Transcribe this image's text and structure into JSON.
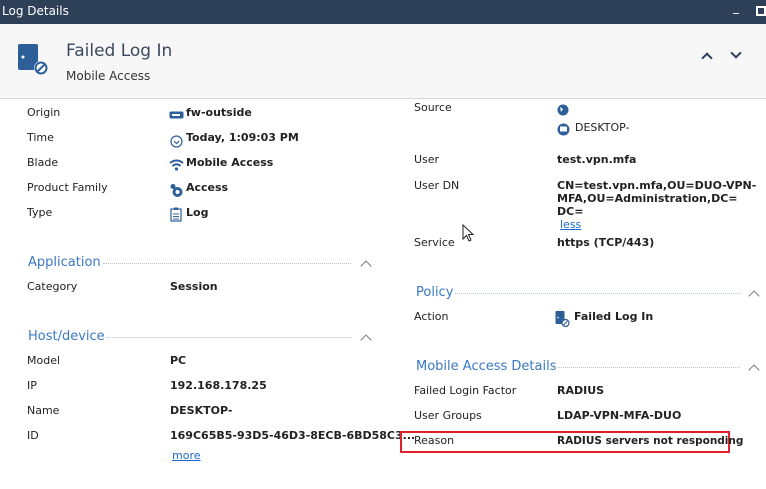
{
  "window": {
    "title": "Log Details"
  },
  "header": {
    "title": "Failed Log In",
    "subtitle": "Mobile Access"
  },
  "colors": {
    "titlebar": "#2e3f58",
    "accent": "#3a78c3",
    "icon": "#2d5f99",
    "highlight": "#e0202a"
  },
  "general": [
    {
      "label": "Origin",
      "value": "fw-outside",
      "icon": "gateway-icon"
    },
    {
      "label": "Time",
      "value": "Today, 1:09:03 PM",
      "icon": "clock-icon"
    },
    {
      "label": "Blade",
      "value": "Mobile Access",
      "icon": "wifi-icon"
    },
    {
      "label": "Product Family",
      "value": "Access",
      "icon": "access-icon"
    },
    {
      "label": "Type",
      "value": "Log",
      "icon": "log-icon"
    }
  ],
  "application": {
    "title": "Application",
    "rows": [
      {
        "label": "Category",
        "value": "Session"
      }
    ]
  },
  "host": {
    "title": "Host/device",
    "rows": [
      {
        "label": "Model",
        "value": "PC"
      },
      {
        "label": "IP",
        "value": "192.168.178.25"
      },
      {
        "label": "Name",
        "value": "DESKTOP-"
      },
      {
        "label": "ID",
        "value": "169C65B5-93D5-46D3-8ECB-6BD58C3..."
      }
    ],
    "more": "more"
  },
  "traffic": {
    "source_label": "Source",
    "source_host": "DESKTOP-",
    "user_label": "User",
    "user": "test.vpn.mfa",
    "userdn_label": "User DN",
    "userdn_lines": [
      "CN=test.vpn.mfa,OU=DUO-VPN-",
      "MFA,OU=Administration,DC=",
      "DC="
    ],
    "less": "less",
    "service_label": "Service",
    "service": "https (TCP/443)"
  },
  "policy": {
    "title": "Policy",
    "action_label": "Action",
    "action": "Failed Log In"
  },
  "mobile": {
    "title": "Mobile Access Details",
    "rows": [
      {
        "label": "Failed Login Factor",
        "value": "RADIUS"
      },
      {
        "label": "User Groups",
        "value": "LDAP-VPN-MFA-DUO"
      },
      {
        "label": "Reason",
        "value": "RADIUS servers not responding"
      }
    ]
  }
}
